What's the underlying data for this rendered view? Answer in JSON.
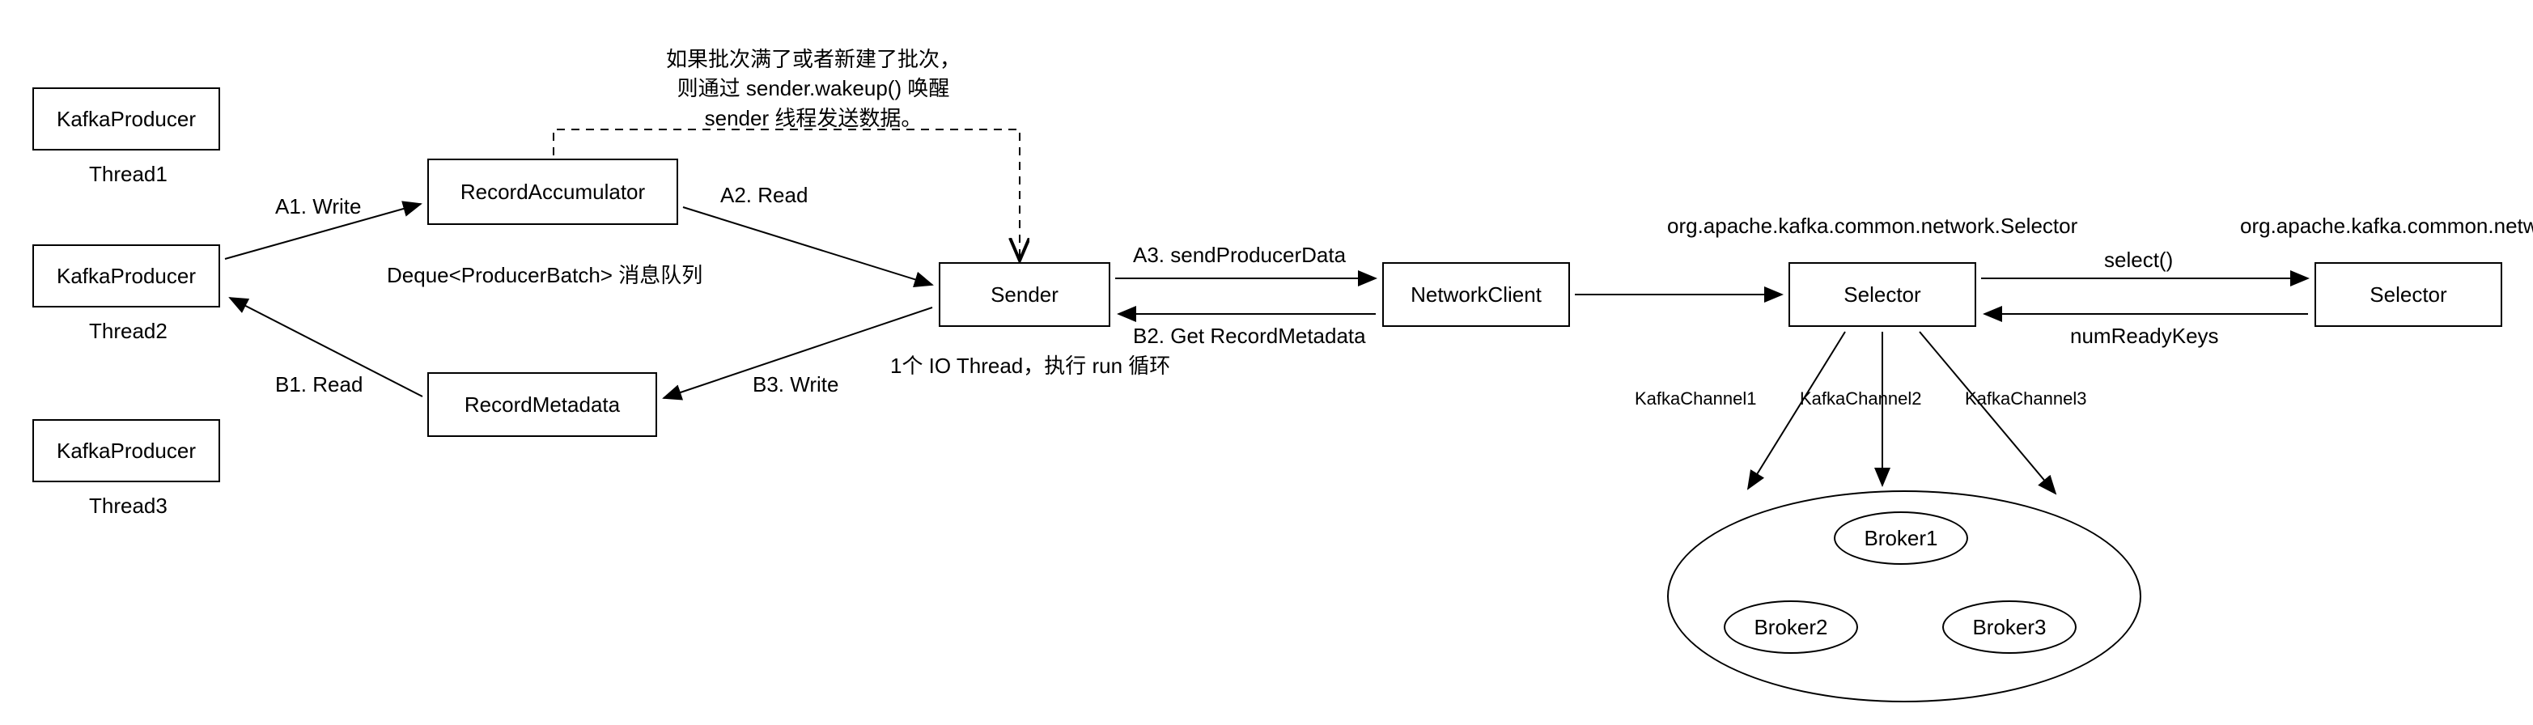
{
  "annotation": {
    "line1": "如果批次满了或者新建了批次，",
    "line2": "则通过 sender.wakeup() 唤醒",
    "line3": "sender 线程发送数据。"
  },
  "producers": {
    "p1": "KafkaProducer",
    "p1_thread": "Thread1",
    "p2": "KafkaProducer",
    "p2_thread": "Thread2",
    "p3": "KafkaProducer",
    "p3_thread": "Thread3"
  },
  "record_accumulator": "RecordAccumulator",
  "deque_note": "Deque<ProducerBatch> 消息队列",
  "record_metadata": "RecordMetadata",
  "sender": "Sender",
  "sender_note": "1个 IO Thread，执行 run 循环",
  "network_client": "NetworkClient",
  "selector1": "Selector",
  "selector1_header": "org.apache.kafka.common.network.Selector",
  "selector2": "Selector",
  "selector2_header": "org.apache.kafka.common.network.Selector",
  "edges": {
    "a1": "A1. Write",
    "a2": "A2. Read",
    "a3": "A3. sendProducerData",
    "b1": "B1. Read",
    "b2": "B2. Get RecordMetadata",
    "b3": "B3. Write",
    "select": "select()",
    "numReadyKeys": "numReadyKeys"
  },
  "channels": {
    "c1": "KafkaChannel1",
    "c2": "KafkaChannel2",
    "c3": "KafkaChannel3"
  },
  "brokers": {
    "b1": "Broker1",
    "b2": "Broker2",
    "b3": "Broker3"
  }
}
